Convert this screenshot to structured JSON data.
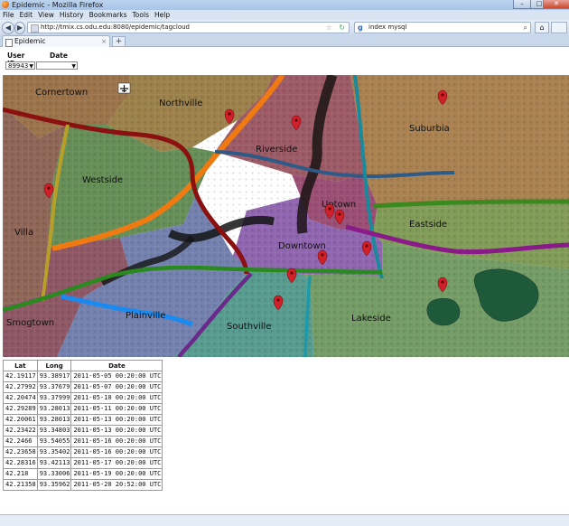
{
  "window": {
    "title": "Epidemic - Mozilla Firefox",
    "controls": [
      "–",
      "□",
      "✕"
    ]
  },
  "menu": [
    "File",
    "Edit",
    "View",
    "History",
    "Bookmarks",
    "Tools",
    "Help"
  ],
  "nav": {
    "back_icon": "left-arrow-icon",
    "forward_icon": "right-arrow-icon",
    "url": "http://tmix.cs.odu.edu:8080/epidemic/tagcloud",
    "search_text": "index mysql"
  },
  "tab": {
    "label": "Epidemic",
    "close": "×",
    "new_tab": "+"
  },
  "filters": {
    "user_id_label": "User ID",
    "user_id_value": "89943",
    "date_label": "Date",
    "date_value": ""
  },
  "map": {
    "districts": [
      "Cornertown",
      "Northville",
      "Suburbia",
      "Riverside",
      "Westside",
      "Uptown",
      "Eastside",
      "Villa",
      "Downtown",
      "Smogtown",
      "Plainville",
      "Southville",
      "Lakeside"
    ],
    "colors": {
      "cornertown": "#8a5a2c",
      "northville": "#8a6a2a",
      "suburbia": "#9a6a30",
      "riverside": "#8a3d4a",
      "westside": "#4a7a3a",
      "uptown": "#8a2f5a",
      "eastside": "#6a8a3a",
      "villa": "#7a4a3a",
      "downtown": "#7a4aa0",
      "smogtown": "#7a3a4a",
      "plainville": "#5a6aa0",
      "southville": "#3a8a7a",
      "lakeside": "#5a8a4a",
      "river": "#1a1414",
      "marker": "#d0202a"
    }
  },
  "table": {
    "headers": [
      "Lat",
      "Long",
      "Date"
    ],
    "rows": [
      [
        "42.19117",
        "93.38917",
        "2011-05-05 00:20:00 UTC"
      ],
      [
        "42.27992",
        "93.37679",
        "2011-05-07 00:20:00 UTC"
      ],
      [
        "42.20474",
        "93.37999",
        "2011-05-10 00:20:00 UTC"
      ],
      [
        "42.29289",
        "93.28013",
        "2011-05-11 00:20:00 UTC"
      ],
      [
        "42.20061",
        "93.28013",
        "2011-05-13 00:20:00 UTC"
      ],
      [
        "42.23422",
        "93.34803",
        "2011-05-13 00:20:00 UTC"
      ],
      [
        "42.2466",
        "93.54055",
        "2011-05-16 00:20:00 UTC"
      ],
      [
        "42.23658",
        "93.35402",
        "2011-05-16 00:20:00 UTC"
      ],
      [
        "42.28316",
        "93.42113",
        "2011-05-17 00:20:00 UTC"
      ],
      [
        "42.218",
        "93.33006",
        "2011-05-19 00:20:00 UTC"
      ],
      [
        "42.21358",
        "93.35962",
        "2011-05-20 20:52:00 UTC"
      ]
    ]
  }
}
